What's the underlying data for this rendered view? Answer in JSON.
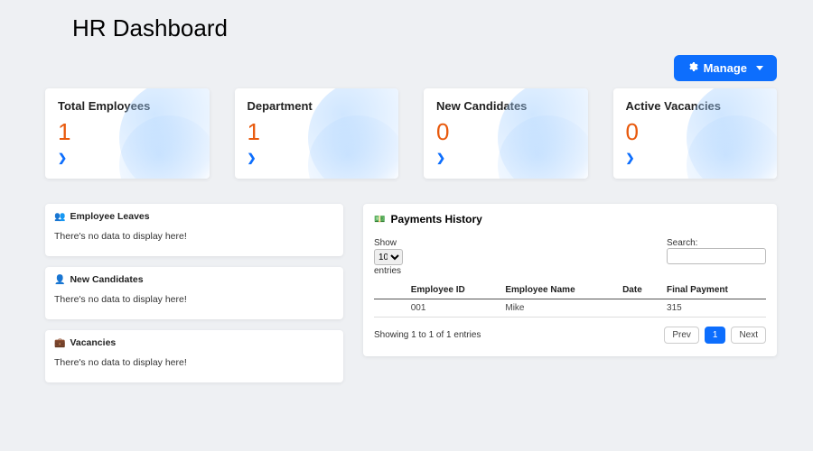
{
  "page_title": "HR Dashboard",
  "manage_button": {
    "label": "Manage"
  },
  "cards": [
    {
      "title": "Total Employees",
      "value": "1"
    },
    {
      "title": "Department",
      "value": "1"
    },
    {
      "title": "New Candidates",
      "value": "0"
    },
    {
      "title": "Active Vacancies",
      "value": "0"
    }
  ],
  "side_panels": [
    {
      "icon": "👥",
      "title": "Employee Leaves",
      "empty_text": "There's no data to display here!"
    },
    {
      "icon": "👤",
      "title": "New Candidates",
      "empty_text": "There's no data to display here!"
    },
    {
      "icon": "💼",
      "title": "Vacancies",
      "empty_text": "There's no data to display here!"
    }
  ],
  "payments": {
    "icon": "💵",
    "title": "Payments History",
    "show_label": "Show",
    "entries_label": "entries",
    "length_value": "10",
    "search_label": "Search:",
    "search_value": "",
    "columns": [
      "Employee ID",
      "Employee Name",
      "Date",
      "Final Payment"
    ],
    "rows": [
      {
        "id": "001",
        "name": "Mike",
        "date": "",
        "final": "315"
      }
    ],
    "info": "Showing 1 to 1 of 1 entries",
    "pager": {
      "prev": "Prev",
      "next": "Next",
      "current": "1"
    }
  }
}
